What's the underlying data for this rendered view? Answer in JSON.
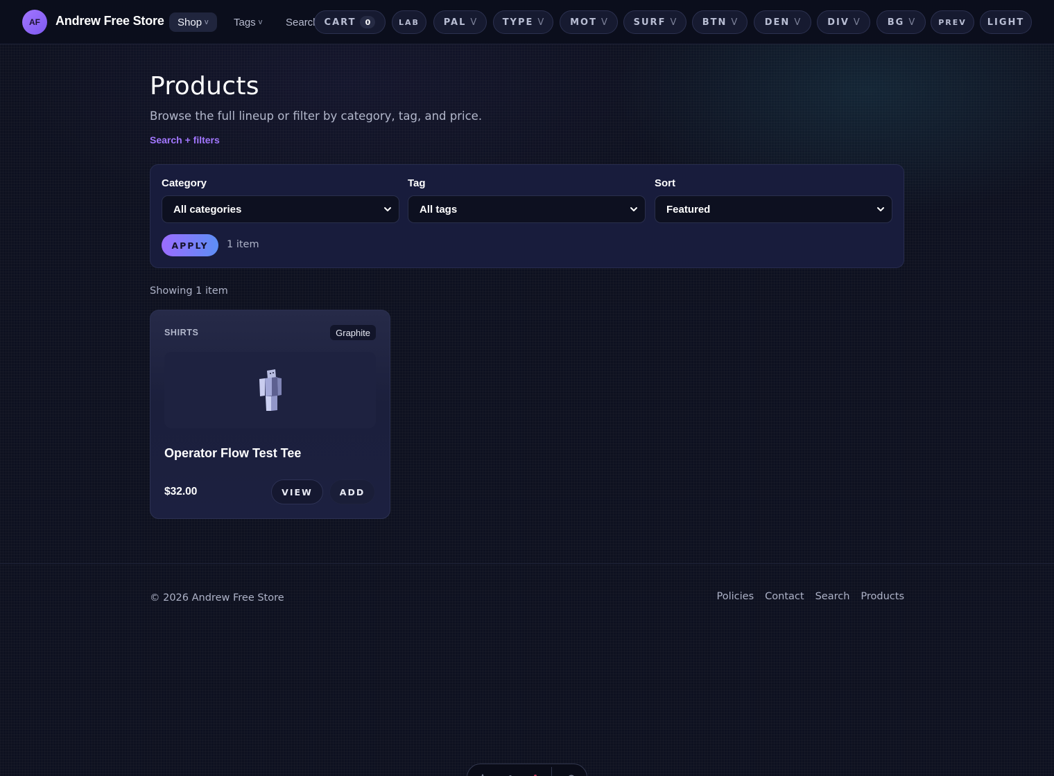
{
  "header": {
    "brand_initials": "AF",
    "brand_name": "Andrew Free Store",
    "nav": {
      "shop": "Shop",
      "tags": "Tags",
      "search": "Search"
    },
    "caret": "v",
    "cart_label": "CART",
    "cart_count": "0",
    "pills": {
      "lab": "LAB",
      "pal": "PAL",
      "type": "TYPE",
      "mot": "MOT",
      "surf": "SURF",
      "btn": "BTN",
      "den": "DEN",
      "div": "DIV",
      "bg": "BG",
      "prev": "PREV",
      "light": "LIGHT"
    },
    "pill_suffix": "V"
  },
  "page": {
    "title": "Products",
    "subtitle": "Browse the full lineup or filter by category, tag, and price.",
    "filters_link": "Search + filters"
  },
  "filters": {
    "category_label": "Category",
    "category_value": "All categories",
    "tag_label": "Tag",
    "tag_value": "All tags",
    "sort_label": "Sort",
    "sort_value": "Featured",
    "apply_label": "APPLY",
    "count_text": "1 item"
  },
  "results": {
    "showing_text": "Showing 1 item"
  },
  "products": [
    {
      "category": "SHIRTS",
      "tag": "Graphite",
      "name": "Operator Flow Test Tee",
      "price": "$32.00",
      "view_label": "VIEW",
      "add_label": "ADD"
    }
  ],
  "footer": {
    "copyright": "© 2026 Andrew Free Store",
    "links": [
      "Policies",
      "Contact",
      "Search",
      "Products"
    ]
  },
  "colors": {
    "accent": "#a277ff",
    "background": "#0e1120",
    "panel": "#181c3c"
  }
}
